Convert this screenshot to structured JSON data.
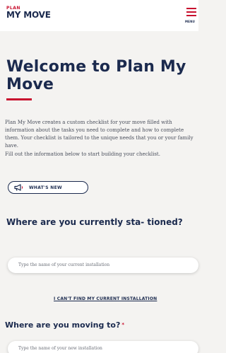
{
  "header": {
    "logo_line1": "PLAN",
    "logo_line2": "MY MOVE",
    "menu_label": "MENU"
  },
  "main": {
    "title": "Welcome to Plan My Move",
    "intro": "Plan My Move creates a custom checklist for your move filled with information about the tasks you need to complete and how to complete them. Your checklist is tailored to the unique needs that you or your family have.",
    "fill_out": "Fill out the information below to start building your checklist.",
    "whats_new_label": "WHAT'S NEW",
    "question_current": "Where are you currently sta- tioned?",
    "current_placeholder": "Type the name of your current installation",
    "cant_find_link": "I CAN'T FIND MY CURRENT INSTALLATION",
    "question_moving": "Where are you moving to?",
    "required_mark": "*",
    "moving_placeholder": "Type the name of your new installation"
  },
  "colors": {
    "brand_red": "#c8102e",
    "navy": "#1b2a4e",
    "background": "#f4f3f1"
  },
  "icons": {
    "menu": "hamburger-icon",
    "whats_new": "megaphone-icon"
  }
}
